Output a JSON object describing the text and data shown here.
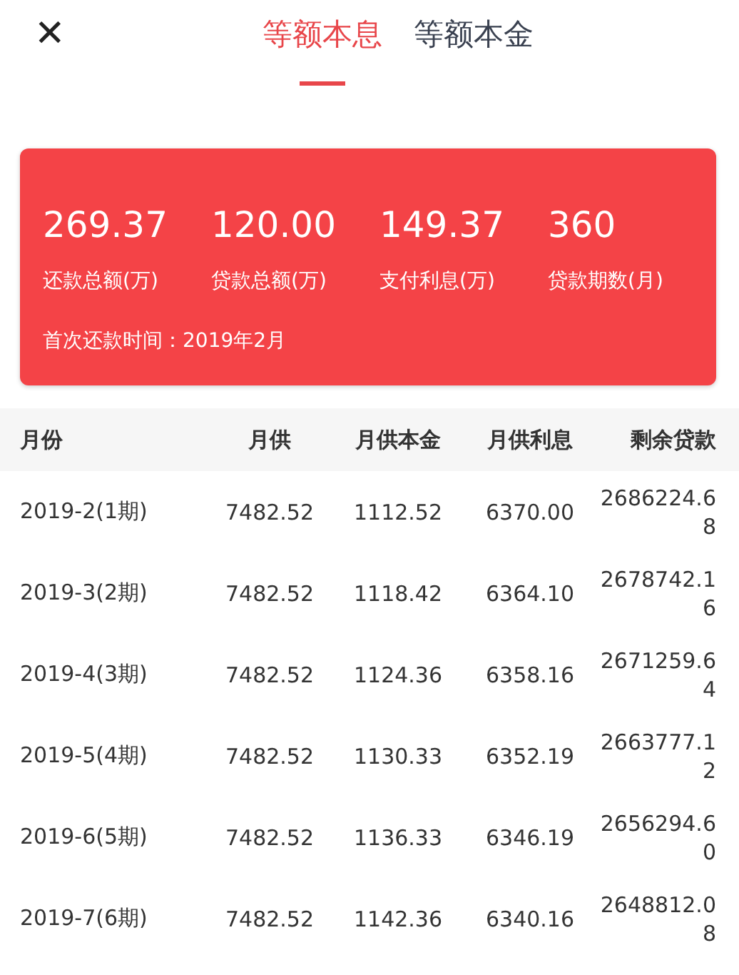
{
  "close_label": "✕",
  "tabs": [
    {
      "label": "等额本息",
      "selected": true
    },
    {
      "label": "等额本金",
      "selected": false
    }
  ],
  "summary": {
    "stats": [
      {
        "value": "269.37",
        "label": "还款总额(万)"
      },
      {
        "value": "120.00",
        "label": "贷款总额(万)"
      },
      {
        "value": "149.37",
        "label": "支付利息(万)"
      },
      {
        "value": "360",
        "label": "贷款期数(月)"
      }
    ],
    "first_payment": "首次还款时间：2019年2月"
  },
  "table": {
    "columns": [
      "月份",
      "月供",
      "月供本金",
      "月供利息",
      "剩余贷款"
    ],
    "rows": [
      [
        "2019-2(1期)",
        "7482.52",
        "1112.52",
        "6370.00",
        "2686224.68"
      ],
      [
        "2019-3(2期)",
        "7482.52",
        "1118.42",
        "6364.10",
        "2678742.16"
      ],
      [
        "2019-4(3期)",
        "7482.52",
        "1124.36",
        "6358.16",
        "2671259.64"
      ],
      [
        "2019-5(4期)",
        "7482.52",
        "1130.33",
        "6352.19",
        "2663777.12"
      ],
      [
        "2019-6(5期)",
        "7482.52",
        "1136.33",
        "6346.19",
        "2656294.60"
      ],
      [
        "2019-7(6期)",
        "7482.52",
        "1142.36",
        "6340.16",
        "2648812.08"
      ]
    ]
  }
}
